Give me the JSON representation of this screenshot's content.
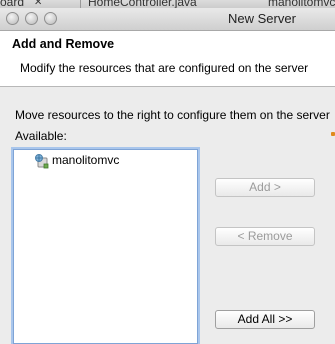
{
  "background_tabs": {
    "tab1": "oard",
    "tab2": "HomeController.java",
    "tab3": "manolitomvc"
  },
  "window": {
    "title": "New Server"
  },
  "header": {
    "title": "Add and Remove",
    "description": "Modify the resources that are configured on the server"
  },
  "body": {
    "instruction": "Move resources to the right to configure them on the server",
    "available_label": "Available:",
    "available_items": [
      {
        "label": "manolitomvc",
        "icon": "web-project-icon"
      }
    ]
  },
  "buttons": {
    "add": "Add >",
    "remove": "< Remove",
    "add_all": "Add All >>"
  },
  "colors": {
    "list_focus_border": "#7fa4d6",
    "disabled_text": "#9b9b9b",
    "header_bg": "#ffffff",
    "dialog_bg": "#ececec"
  }
}
